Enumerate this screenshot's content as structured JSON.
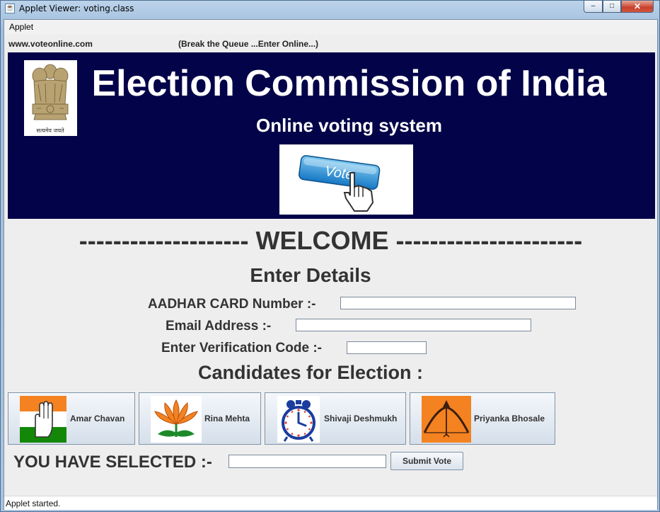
{
  "window": {
    "title": "Applet Viewer: voting.class",
    "minimize_glyph": "–",
    "maximize_glyph": "□",
    "close_glyph": "✕"
  },
  "menu": {
    "applet": "Applet"
  },
  "header": {
    "site": "www.voteonline.com",
    "tagline": "(Break the Queue ...Enter Online...)"
  },
  "banner": {
    "title": "Election Commission of India",
    "subtitle": "Online voting system",
    "vote_button_text": "Vote",
    "emblem_motto": "सत्यमेव जयते"
  },
  "welcome": "-------------------- WELCOME ----------------------",
  "form": {
    "heading": "Enter Details",
    "aadhar_label": "AADHAR CARD Number   :-",
    "aadhar_value": "",
    "email_label": "Email Address   :-",
    "email_value": "",
    "code_label": "Enter Verification Code  :-",
    "code_value": ""
  },
  "candidates": {
    "heading": "Candidates for Election :",
    "items": [
      {
        "name": "Amar Chavan",
        "symbol": "hand-icon"
      },
      {
        "name": "Rina Mehta",
        "symbol": "lotus-icon"
      },
      {
        "name": "Shivaji Deshmukh",
        "symbol": "clock-icon"
      },
      {
        "name": "Priyanka Bhosale",
        "symbol": "bow-arrow-icon"
      }
    ]
  },
  "selection": {
    "label": "YOU HAVE SELECTED :-",
    "value": "",
    "submit_label": "Submit Vote"
  },
  "status": "Applet started.",
  "colors": {
    "banner_bg": "#020348",
    "saffron": "#f48220",
    "green": "#138808",
    "lotus_green": "#1d8a2a",
    "clock_blue": "#1a3d9e"
  }
}
